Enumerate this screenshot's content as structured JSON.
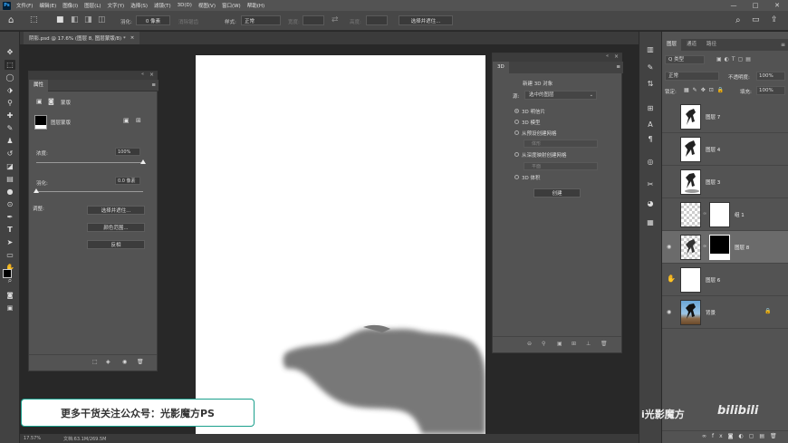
{
  "menubar": {
    "app_icon": "Ps",
    "items": [
      "文件(F)",
      "编辑(E)",
      "图像(I)",
      "图层(L)",
      "文字(Y)",
      "选择(S)",
      "滤镜(T)",
      "3D(D)",
      "视图(V)",
      "窗口(W)",
      "帮助(H)"
    ],
    "window_controls": [
      "—",
      "□",
      "✕"
    ]
  },
  "options": {
    "feather_label": "羽化:",
    "feather_value": "0 像素",
    "antialias_label": "消除锯齿",
    "style_label": "样式:",
    "style_value": "正常",
    "width_label": "宽度:",
    "height_label": "高度:",
    "select_mask_label": "选择并遮住..."
  },
  "document": {
    "tab_title": "阴影.psd @ 17.6% (图层 8, 图层蒙版/8) *",
    "close": "×",
    "zoom": "17.57%",
    "doc_info": "文档:63.1M/269.5M"
  },
  "properties": {
    "tab": "属性",
    "section": "蒙版",
    "layer_mask_label": "图层蒙版",
    "density_label": "浓度:",
    "density_value": "100%",
    "density": 1.0,
    "feather_label": "羽化:",
    "feather_value": "0.0 像素",
    "feather": 0.0,
    "adjust_label": "调整:",
    "select_mask": "选择并遮住...",
    "color_range": "颜色范围...",
    "invert": "反相"
  },
  "panel3d": {
    "tab": "3D",
    "title": "新建 3D 对象",
    "source_label": "源:",
    "source_value": "选中的图层",
    "options": [
      {
        "label": "3D 明信片",
        "checked": true
      },
      {
        "label": "3D 模型",
        "checked": false
      },
      {
        "label": "从预设创建网格",
        "checked": false
      },
      {
        "label": "从深度映射创建网格",
        "checked": false
      },
      {
        "label": "3D 体积",
        "checked": false
      }
    ],
    "preset_value": "体形",
    "depth_value": "平面",
    "create_button": "创建"
  },
  "layers_panel": {
    "tabs": [
      "图层",
      "通道",
      "路径"
    ],
    "filter_label": "Q 类型",
    "blend_mode": "正常",
    "opacity_label": "不透明度:",
    "opacity_value": "100%",
    "lock_label": "锁定:",
    "fill_label": "填充:",
    "fill_value": "100%",
    "layers": [
      {
        "name": "图层 7",
        "visible": false,
        "selected": false
      },
      {
        "name": "图层 4",
        "visible": false,
        "selected": false
      },
      {
        "name": "图层 3",
        "visible": false,
        "selected": false
      },
      {
        "name": "组 1",
        "visible": false,
        "selected": false
      },
      {
        "name": "图层 8",
        "visible": true,
        "selected": true
      },
      {
        "name": "图层 6",
        "visible": true,
        "selected": false
      },
      {
        "name": "背景",
        "visible": true,
        "selected": false
      }
    ],
    "lock_icon": "🔒"
  },
  "overlay": {
    "promo": "更多干货关注公众号：光影魔方PS",
    "brand": "i光影魔方",
    "bilibili": "bilibili"
  }
}
